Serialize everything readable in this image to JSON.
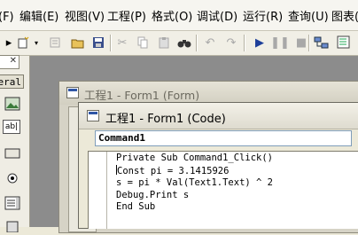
{
  "menu": [
    {
      "label": "(F)"
    },
    {
      "label": "编辑(E)"
    },
    {
      "label": "视图(V)"
    },
    {
      "label": "工程(P)"
    },
    {
      "label": "格式(O)"
    },
    {
      "label": "调试(D)"
    },
    {
      "label": "运行(R)"
    },
    {
      "label": "查询(U)"
    },
    {
      "label": "图表("
    }
  ],
  "toolbox": {
    "tab_label": "eral",
    "textbox_icon_text": "ab|"
  },
  "form_window": {
    "title": "工程1 - Form1 (Form)"
  },
  "code_window": {
    "title": "工程1 - Form1 (Code)",
    "object_combo": "Command1",
    "code_lines": [
      "Private Sub Command1_Click()",
      "Const pi = 3.1415926",
      "s = pi * Val(Text1.Text) ^ 2",
      "Debug.Print s",
      "End Sub"
    ]
  },
  "colors": {
    "caption_active": "#e6e3d7",
    "desktop": "#8c8c8c"
  }
}
